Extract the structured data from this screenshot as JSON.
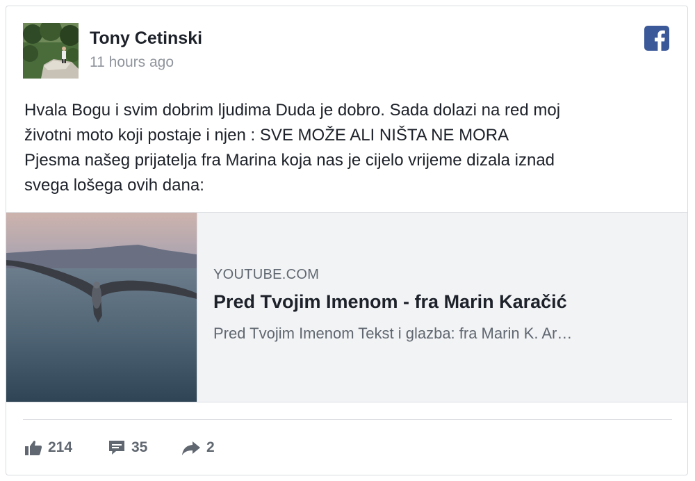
{
  "post": {
    "author": "Tony Cetinski",
    "time": "11 hours ago",
    "text_lines": [
      "Hvala Bogu i svim dobrim ljudima Duda je dobro. Sada dolazi na red moj",
      "životni moto koji postaje i njen : SVE MOŽE ALI NIŠTA NE MORA",
      "Pjesma našeg prijatelja fra Marina koja nas je cijelo vrijeme dizala iznad",
      "svega lošega ovih dana:"
    ]
  },
  "link": {
    "domain": "YOUTUBE.COM",
    "title": "Pred Tvojim Imenom - fra Marin Karačić",
    "description": "Pred Tvojim Imenom Tekst i glazba: fra Marin K. Ar…"
  },
  "actions": {
    "likes": "214",
    "comments": "35",
    "shares": "2"
  },
  "icons": {
    "brand": "facebook-icon",
    "like": "thumbs-up-icon",
    "comment": "comment-bubble-icon",
    "share": "share-arrow-icon"
  },
  "colors": {
    "facebook_blue": "#3b5998",
    "text": "#1d2129",
    "muted": "#90949c",
    "preview_bg": "#f2f3f5"
  }
}
